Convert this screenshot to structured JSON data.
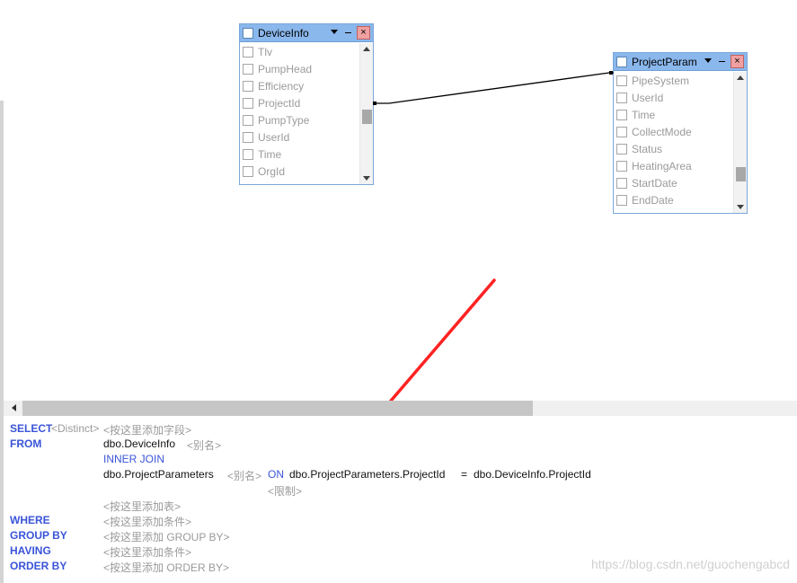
{
  "tables": [
    {
      "title": "DeviceInfo",
      "columns": [
        "Tlv",
        "PumpHead",
        "Efficiency",
        "ProjectId",
        "PumpType",
        "UserId",
        "Time",
        "OrgId"
      ]
    },
    {
      "title": "ProjectParam",
      "columns": [
        "PipeSystem",
        "UserId",
        "Time",
        "CollectMode",
        "Status",
        "HeatingArea",
        "StartDate",
        "EndDate"
      ]
    }
  ],
  "title_bar_glyphs": {
    "close": "×"
  },
  "sql": {
    "select_kw": "SELECT",
    "select_distinct": "<Distinct>",
    "select_fields": "<按这里添加字段>",
    "from_kw": "FROM",
    "from_table": "dbo.DeviceInfo",
    "from_alias": "<别名>",
    "join_type": "INNER JOIN",
    "join_table": "dbo.ProjectParameters",
    "join_alias": "<别名>",
    "on_kw": "ON",
    "on_left": "dbo.ProjectParameters.ProjectId",
    "on_op": "=",
    "on_right": "dbo.DeviceInfo.ProjectId",
    "limit": "<限制>",
    "add_table": "<按这里添加表>",
    "where_kw": "WHERE",
    "where_val": "<按这里添加条件>",
    "groupby_kw": "GROUP BY",
    "groupby_val": "<按这里添加 GROUP BY>",
    "having_kw": "HAVING",
    "having_val": "<按这里添加条件>",
    "orderby_kw": "ORDER BY",
    "orderby_val": "<按这里添加 ORDER BY>"
  },
  "watermark": "https://blog.csdn.net/guochengabcd",
  "colors": {
    "keyword": "#3a54d8",
    "title_bar": "#8ab7ec",
    "arrow": "#ff2222"
  }
}
